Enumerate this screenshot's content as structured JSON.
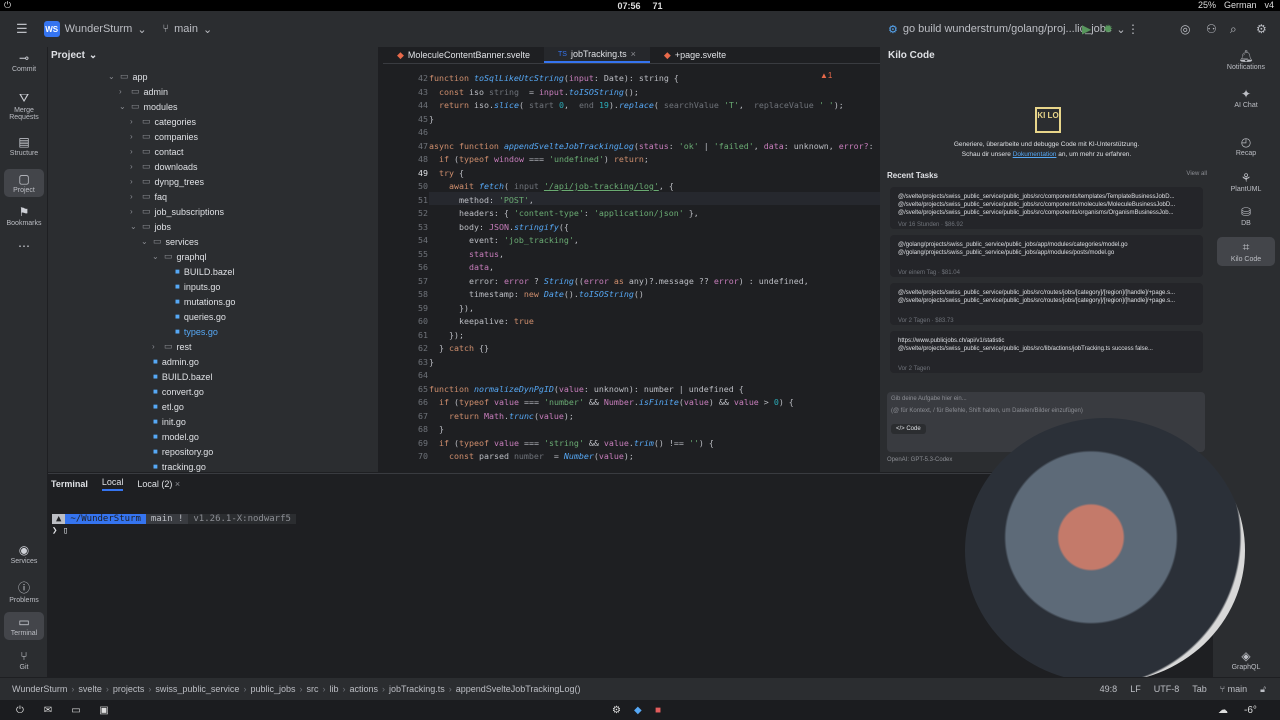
{
  "system": {
    "time": "07:56",
    "notifications": "71",
    "battery": "25%",
    "keyboard": "German",
    "version": "v4"
  },
  "titlebar": {
    "project_badge": "WS",
    "project_name": "WunderSturm",
    "branch": "main",
    "run_config": "go build wunderstrum/golang/proj...lic_jobs"
  },
  "left_strip": [
    {
      "label": "Commit",
      "icon": "commit-icon"
    },
    {
      "label": "Merge Requests",
      "icon": "merge-icon"
    },
    {
      "label": "Structure",
      "icon": "structure-icon"
    },
    {
      "label": "Project",
      "icon": "folder-icon"
    },
    {
      "label": "Bookmarks",
      "icon": "bookmark-icon"
    },
    {
      "label": "Services",
      "icon": "services-icon"
    },
    {
      "label": "Problems",
      "icon": "problems-icon"
    },
    {
      "label": "Terminal",
      "icon": "terminal-icon"
    },
    {
      "label": "Git",
      "icon": "git-icon"
    }
  ],
  "project": {
    "title": "Project",
    "tree": [
      {
        "name": "app",
        "type": "folder",
        "depth": 5
      },
      {
        "name": "admin",
        "type": "folder",
        "depth": 6
      },
      {
        "name": "modules",
        "type": "folder",
        "depth": 6
      },
      {
        "name": "categories",
        "type": "folder",
        "depth": 7
      },
      {
        "name": "companies",
        "type": "folder",
        "depth": 7
      },
      {
        "name": "contact",
        "type": "folder",
        "depth": 7
      },
      {
        "name": "downloads",
        "type": "folder",
        "depth": 7
      },
      {
        "name": "dynpg_trees",
        "type": "folder",
        "depth": 7
      },
      {
        "name": "faq",
        "type": "folder",
        "depth": 7
      },
      {
        "name": "job_subscriptions",
        "type": "folder",
        "depth": 7
      },
      {
        "name": "jobs",
        "type": "folder",
        "depth": 7
      },
      {
        "name": "services",
        "type": "folder",
        "depth": 8
      },
      {
        "name": "graphql",
        "type": "folder",
        "depth": 9
      },
      {
        "name": "BUILD.bazel",
        "type": "file",
        "depth": 10
      },
      {
        "name": "inputs.go",
        "type": "file",
        "depth": 10
      },
      {
        "name": "mutations.go",
        "type": "file",
        "depth": 10
      },
      {
        "name": "queries.go",
        "type": "file",
        "depth": 10
      },
      {
        "name": "types.go",
        "type": "file",
        "depth": 10
      },
      {
        "name": "rest",
        "type": "folder",
        "depth": 9
      },
      {
        "name": "admin.go",
        "type": "file",
        "depth": 8
      },
      {
        "name": "BUILD.bazel",
        "type": "file",
        "depth": 8
      },
      {
        "name": "convert.go",
        "type": "file",
        "depth": 8
      },
      {
        "name": "etl.go",
        "type": "file",
        "depth": 8
      },
      {
        "name": "init.go",
        "type": "file",
        "depth": 8
      },
      {
        "name": "model.go",
        "type": "file",
        "depth": 8
      },
      {
        "name": "repository.go",
        "type": "file",
        "depth": 8
      },
      {
        "name": "tracking.go",
        "type": "file",
        "depth": 8
      }
    ]
  },
  "editor": {
    "tabs": [
      "MoleculeContentBanner.svelte",
      "jobTracking.ts",
      "+page.svelte"
    ],
    "active_tab": 1,
    "line_numbers": [
      "42",
      "43",
      "44",
      "45",
      "46",
      "47",
      "48",
      "49",
      "50",
      "51",
      "52",
      "53",
      "54",
      "55",
      "56",
      "57",
      "58",
      "59",
      "60",
      "61",
      "62",
      "63",
      "64",
      "65",
      "66",
      "67",
      "68",
      "69",
      "70"
    ],
    "current_line": "49",
    "warnings": "1"
  },
  "kilo": {
    "title": "Kilo Code",
    "logo": "KI LO",
    "tagline": "Generiere, überarbeite und debugge Code mit KI-Unterstützung.",
    "docs_prefix": "Schau dir unsere",
    "docs_link": "Dokumentation",
    "docs_suffix": "an, um mehr zu erfahren.",
    "recent_title": "Recent Tasks",
    "view_all": "View all",
    "tasks": [
      {
        "text": "@/svelte/projects/swiss_public_service/public_jobs/src/components/templates/TemplateBusinessJobD... @/svelte/projects/swiss_public_service/public_jobs/src/components/molecules/MoleculeBusinessJobD... @/svelte/projects/swiss_public_service/public_jobs/src/components/organisms/OrganismBusinessJob...",
        "meta": "Vor 16 Stunden · $86.92"
      },
      {
        "text": "@/golang/projects/swiss_public_service/public_jobs/app/modules/categories/model.go @/golang/projects/swiss_public_service/public_jobs/app/modules/posts/model.go",
        "meta": "Vor einem Tag · $81.04"
      },
      {
        "text": "@/svelte/projects/swiss_public_service/public_jobs/src/routes/jobs/[category]/[region]/[handle]/+page.s... @/svelte/projects/swiss_public_service/public_jobs/src/routes/jobs/[category]/[region]/[handle]/+page.s...",
        "meta": "Vor 2 Tagen · $83.73"
      },
      {
        "text": "https://www.publicjobs.ch/api/v1/statistic @/svelte/projects/swiss_public_service/public_jobs/src/lib/actions/jobTracking.ts success false...",
        "meta": "Vor 2 Tagen"
      }
    ],
    "input_placeholder": "Gib deine Aufgabe hier ein...",
    "input_hint": "(@ für Kontext, / für Befehle, Shift halten, um Dateien/Bilder einzufügen)",
    "mode": "Code",
    "model": "OpenAI: GPT-5.3-Codex"
  },
  "right_strip": [
    {
      "label": "Notifications",
      "icon": "bell-icon"
    },
    {
      "label": "AI Chat",
      "icon": "ai-icon"
    },
    {
      "label": "Recap",
      "icon": "recap-icon"
    },
    {
      "label": "PlantUML",
      "icon": "plantuml-icon"
    },
    {
      "label": "DB",
      "icon": "db-icon"
    },
    {
      "label": "Kilo Code",
      "icon": "kilo-icon"
    },
    {
      "label": "GraphQL",
      "icon": "graphql-icon"
    }
  ],
  "terminal": {
    "title": "Terminal",
    "tabs": [
      "Local",
      "Local (2)"
    ],
    "prompt_path": "~/WunderSturm",
    "prompt_branch": "main !",
    "prompt_version": "v1.26.1-X:nodwarf5"
  },
  "status": {
    "crumbs": [
      "WunderSturm",
      "svelte",
      "projects",
      "swiss_public_service",
      "public_jobs",
      "src",
      "lib",
      "actions",
      "jobTracking.ts",
      "appendSvelteJobTrackingLog()"
    ],
    "position": "49:8",
    "line_ending": "LF",
    "encoding": "UTF-8",
    "indent": "Tab",
    "branch": "main"
  },
  "taskbar": {
    "temperature": "-6°"
  }
}
